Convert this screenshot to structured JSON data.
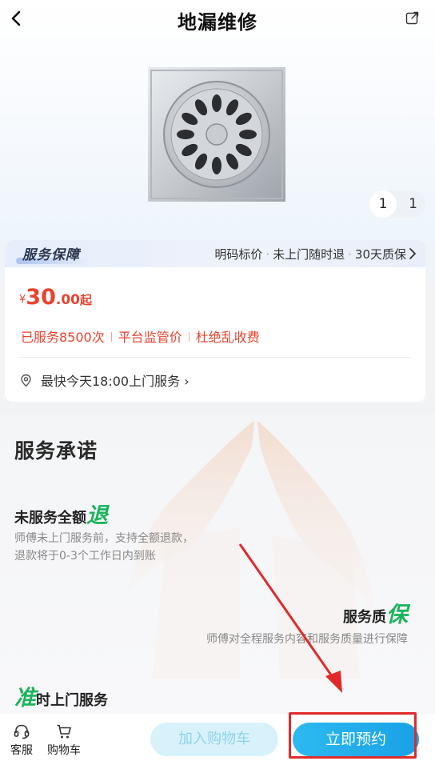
{
  "header": {
    "title": "地漏维修"
  },
  "gallery": {
    "current": "1",
    "total": "1"
  },
  "guarantee": {
    "title": "服务保障",
    "tags": [
      "明码标价",
      "未上门随时退",
      "30天质保"
    ]
  },
  "price": {
    "currency": "¥",
    "integer": "30",
    "decimal": ".00",
    "suffix": "起"
  },
  "stats": [
    "已服务8500次",
    "平台监管价",
    "杜绝乱收费"
  ],
  "location": {
    "text": "最快今天18:00上门服务"
  },
  "promise": {
    "title": "服务承诺",
    "refund_title": "未服务全额",
    "refund_big": "退",
    "refund_desc_1": "师傅未上门服务前，支持全额退款，",
    "refund_desc_2": "退款将于0-3个工作日内到账",
    "quality_title": "服务质",
    "quality_big": "保",
    "quality_desc": "师傅对全程服务内容和服务质量进行保障",
    "ontime_big": "准",
    "ontime_title": "时上门服务"
  },
  "bottom": {
    "service_label": "客服",
    "cart_label": "购物车",
    "add_cart_label": "加入购物车",
    "book_label": "立即预约"
  },
  "colors": {
    "accent": "#1aa8ea",
    "price": "#e8432e",
    "green": "#19b45a",
    "annotation": "#e02a2a"
  }
}
